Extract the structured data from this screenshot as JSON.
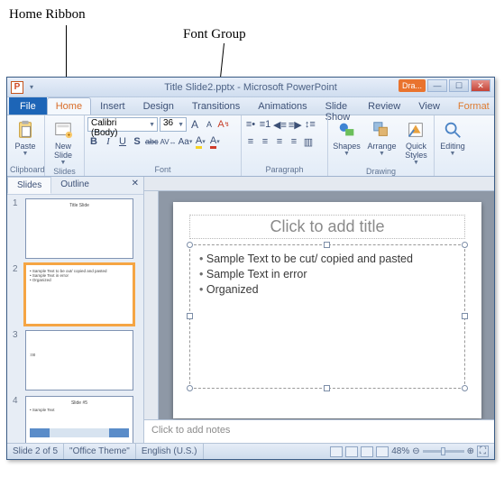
{
  "annotations": {
    "home_ribbon": "Home Ribbon",
    "font_group": "Font Group"
  },
  "title": "Title Slide2.pptx - Microsoft PowerPoint",
  "user_badge": "Dra...",
  "tabs": {
    "file": "File",
    "home": "Home",
    "insert": "Insert",
    "design": "Design",
    "transitions": "Transitions",
    "animations": "Animations",
    "slideshow": "Slide Show",
    "review": "Review",
    "view": "View",
    "format": "Format"
  },
  "ribbon": {
    "clipboard": {
      "label": "Clipboard",
      "paste": "Paste"
    },
    "slides": {
      "label": "Slides",
      "new_slide": "New\nSlide"
    },
    "font": {
      "label": "Font",
      "font_name": "Calibri (Body)",
      "font_size": "36",
      "bold": "B",
      "italic": "I",
      "underline": "U",
      "strike": "abc",
      "shadow": "S",
      "spacing": "AV",
      "case": "Aa",
      "grow": "A",
      "shrink": "A",
      "clear": "A",
      "color": "A"
    },
    "paragraph": {
      "label": "Paragraph"
    },
    "drawing": {
      "label": "Drawing",
      "shapes": "Shapes",
      "arrange": "Arrange",
      "quick_styles": "Quick\nStyles"
    },
    "editing": {
      "label": "Editing",
      "btn": "Editing"
    }
  },
  "panel": {
    "slides_tab": "Slides",
    "outline_tab": "Outline"
  },
  "thumbnails": [
    {
      "n": "1",
      "title": "Title Slide"
    },
    {
      "n": "2",
      "bullets": [
        "Sample Text to be out/ copied and pasted",
        "Sample Text in error",
        "Organized"
      ]
    },
    {
      "n": "3",
      "title": ":00"
    },
    {
      "n": "4",
      "title": "Slide #5",
      "bullets": [
        "Sample Text"
      ]
    }
  ],
  "slide": {
    "title_placeholder": "Click to add title",
    "bullets": [
      "Sample Text to be cut/ copied and pasted",
      "Sample Text in error",
      "Organized"
    ]
  },
  "notes_placeholder": "Click to add notes",
  "status": {
    "slide_of": "Slide 2 of 5",
    "theme": "\"Office Theme\"",
    "language": "English (U.S.)",
    "zoom": "48%"
  }
}
